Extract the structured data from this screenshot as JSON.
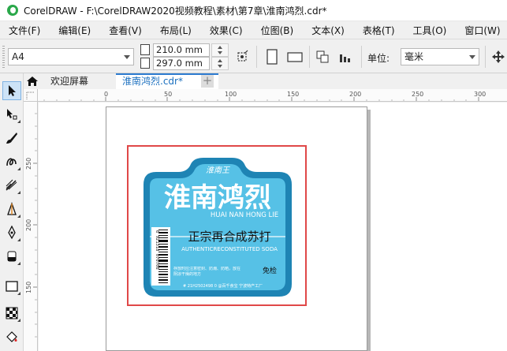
{
  "app": {
    "window_title": "CorelDRAW - F:\\CorelDRAW2020视频教程\\素材\\第7章\\淮南鸿烈.cdr*"
  },
  "menu": [
    "文件(F)",
    "编辑(E)",
    "查看(V)",
    "布局(L)",
    "效果(C)",
    "位图(B)",
    "文本(X)",
    "表格(T)",
    "工具(O)",
    "窗口(W)"
  ],
  "property_bar": {
    "page_size": "A4",
    "width": "210.0 mm",
    "height": "297.0 mm",
    "units_label": "单位:",
    "units_value": "毫米"
  },
  "tabs": {
    "welcome": "欢迎屏幕",
    "document": "淮南鸿烈.cdr*",
    "add": "+"
  },
  "rulers": {
    "horizontal_ticks": [
      "0",
      "50",
      "100",
      "150",
      "200",
      "250",
      "300"
    ],
    "vertical_ticks": [
      "250",
      "200",
      "150"
    ]
  },
  "label": {
    "top_tab_text": "淮南王",
    "brand": "淮南鸿烈",
    "pinyin": "HUAI NAN HONG LIE",
    "slogan": "正宗再合成苏打",
    "english": "AUTHENTICRECONSTITUTED SODA",
    "badge": "免检",
    "note": "存放时应注意密封、防潮、防晒，放在阴凉干燥的地方",
    "barcode_digits": "6 921318 070706",
    "footer": "# 21H2502498 0 @百千食宝  宁波特产工厂"
  },
  "colors": {
    "label_primary": "#1e84b4",
    "label_light": "#56c1e6",
    "selection": "#e04848",
    "active_tab": "#1a6fbf"
  },
  "toolbox_icons": [
    "pick-tool-icon",
    "shape-tool-icon",
    "brush-tool-icon",
    "freehand-tool-icon",
    "artistic-media-icon",
    "contour-icon",
    "pen-icon",
    "eraser-icon",
    "rectangle-icon",
    "checker-icon",
    "fill-icon"
  ]
}
